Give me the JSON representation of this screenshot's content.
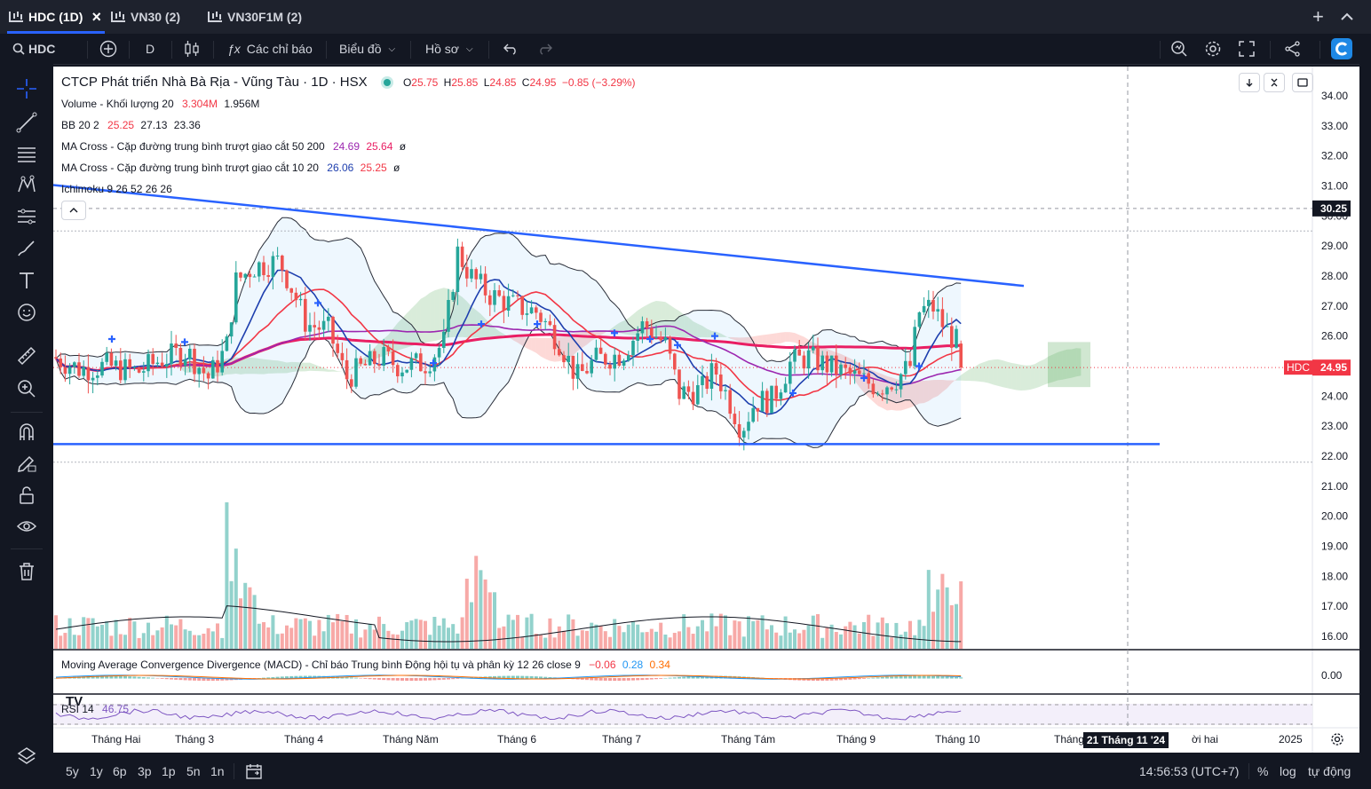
{
  "tabs": [
    {
      "label": "HDC (1D)",
      "active": true,
      "close": "×"
    },
    {
      "label": "VN30 (2)"
    },
    {
      "label": "VN30F1M (2)"
    }
  ],
  "tabbar": {
    "add": "+"
  },
  "toolbar": {
    "symbol": "HDC",
    "interval": "D",
    "indicators": "Các chỉ báo",
    "chart_type": "Biểu đồ",
    "profile": "Hồ sơ"
  },
  "legend": {
    "title": "CTCP Phát triển Nhà Bà Rịa - Vũng Tàu · 1D · HSX",
    "ohlc": {
      "o_label": "O",
      "o": "25.75",
      "h_label": "H",
      "h": "25.85",
      "l_label": "L",
      "l": "24.85",
      "c_label": "C",
      "c": "24.95",
      "change": "−0.85 (−3.29%)"
    },
    "volume": {
      "label": "Volume - Khối lượng 20",
      "v1": "3.304M",
      "v2": "1.956M"
    },
    "bb": {
      "label": "BB 20 2",
      "v1": "25.25",
      "v2": "27.13",
      "v3": "23.36"
    },
    "ma1": {
      "label": "MA Cross - Cặp đường trung bình trượt giao cắt 50 200",
      "v1": "24.69",
      "v2": "25.64",
      "sym": "ø"
    },
    "ma2": {
      "label": "MA Cross - Cặp đường trung bình trượt giao cắt 10 20",
      "v1": "26.06",
      "v2": "25.25",
      "sym": "ø"
    },
    "ichimoku": {
      "label": "Ichimoku 9 26 52 26 26"
    },
    "macd": {
      "label": "Moving Average Convergence Divergence (MACD) - Chỉ báo Trung bình Động hội tụ và phân kỳ 12 26 close 9",
      "v1": "−0.06",
      "v2": "0.28",
      "v3": "0.34"
    },
    "rsi": {
      "label": "RSI 14",
      "v": "46.75"
    }
  },
  "price_axis": {
    "labels": [
      "34.00",
      "33.00",
      "32.00",
      "31.00",
      "30.00",
      "29.00",
      "28.00",
      "27.00",
      "26.00",
      "25.00",
      "24.00",
      "23.00",
      "22.00",
      "21.00",
      "20.00",
      "19.00",
      "18.00",
      "17.00",
      "16.00"
    ],
    "crosshair_label": "30.25",
    "last_label": "24.95",
    "symbol_badge": "HDC"
  },
  "macd_axis": {
    "label": "0.00"
  },
  "time_axis": {
    "labels": [
      "Tháng Hai",
      "Tháng 3",
      "Tháng 4",
      "Tháng Năm",
      "Tháng 6",
      "Tháng 7",
      "Tháng Tám",
      "Tháng 9",
      "Tháng 10",
      "Tháng 11",
      "ời hai",
      "2025"
    ],
    "crosshair_label": "21 Tháng 11 '24"
  },
  "bottombar": {
    "ranges": [
      "5y",
      "1y",
      "6p",
      "3p",
      "1p",
      "5n",
      "1n"
    ],
    "clock": "14:56:53 (UTC+7)",
    "percent": "%",
    "log": "log",
    "auto": "tự động"
  },
  "colors": {
    "up": "#26a69a",
    "down": "#ef5350",
    "trend": "#2962ff",
    "ma200": "#e91e63",
    "ma50": "#9c27b0",
    "ma10": "#1e3fae",
    "ma20": "#f23645",
    "bg_dark": "#131722"
  },
  "chart_data": {
    "type": "candlestick",
    "y_range": [
      15.7,
      34.5
    ],
    "current_price": 24.95,
    "crosshair_price": 30.25,
    "support_level": 22.4,
    "resistance_line": {
      "from": {
        "period": "Tháng Hai",
        "price": 31.0
      },
      "to": {
        "period": "Tháng 11",
        "price": 27.7
      }
    },
    "approx_close_by_month": [
      {
        "month": "Tháng Hai",
        "close": 25.1
      },
      {
        "month": "Tháng 3",
        "close": 25.3
      },
      {
        "month": "Tháng 4",
        "close": 28.3
      },
      {
        "month": "Tháng Năm",
        "close": 25.0
      },
      {
        "month": "Tháng 6",
        "close": 27.2
      },
      {
        "month": "Tháng 7",
        "close": 25.7
      },
      {
        "month": "Tháng Tám",
        "close": 22.9
      },
      {
        "month": "Tháng 9",
        "close": 25.0
      },
      {
        "month": "Tháng 10",
        "close": 27.0
      }
    ]
  }
}
